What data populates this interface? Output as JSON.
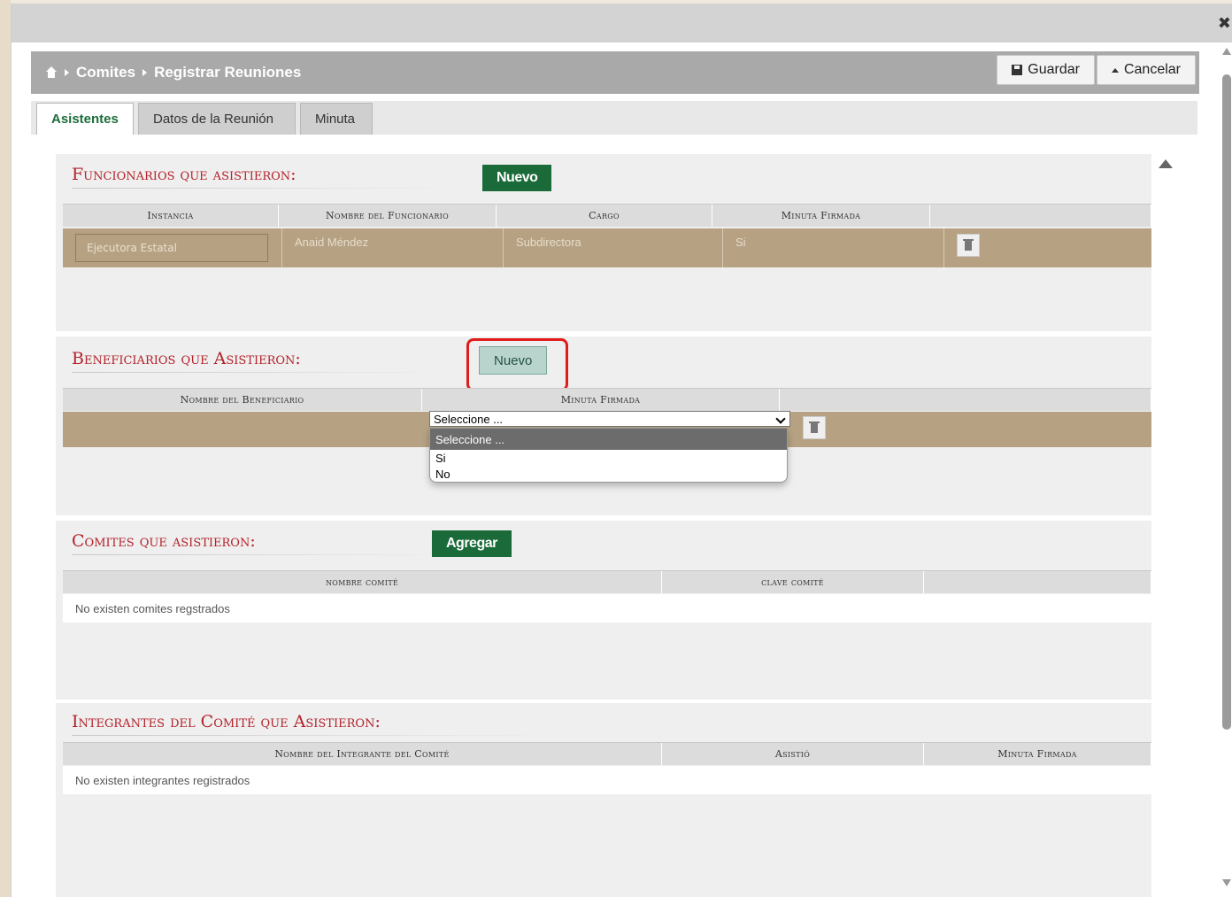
{
  "breadcrumb": {
    "items": [
      "Comites",
      "Registrar Reuniones"
    ]
  },
  "header": {
    "save_label": "Guardar",
    "cancel_label": "Cancelar"
  },
  "tabs": [
    {
      "label": "Asistentes",
      "active": true
    },
    {
      "label": "Datos de la Reunión",
      "active": false
    },
    {
      "label": "Minuta",
      "active": false
    }
  ],
  "funcionarios": {
    "title": "Funcionarios que asistieron:",
    "new_label": "Nuevo",
    "columns": [
      "Instancia",
      "Nombre del Funcionario",
      "Cargo",
      "Minuta Firmada",
      ""
    ],
    "rows": [
      {
        "instancia": "Ejecutora Estatal",
        "nombre": "Anaid Méndez",
        "cargo": "Subdirectora",
        "minuta": "Si"
      }
    ]
  },
  "beneficiarios": {
    "title": "Beneficiarios que Asistieron:",
    "new_label": "Nuevo",
    "columns": [
      "Nombre del Beneficiario",
      "Minuta Firmada",
      ""
    ],
    "select_value": "Seleccione ...",
    "options": [
      "Seleccione ...",
      "Si",
      "No"
    ]
  },
  "comites": {
    "title": "Comites que asistieron:",
    "add_label": "Agregar",
    "columns": [
      "nombre comité",
      "clave comité",
      ""
    ],
    "empty_text": "No existen comites regstrados"
  },
  "integrantes": {
    "title": "Integrantes del Comité que Asistieron:",
    "columns": [
      "Nombre del Integrante del Comité",
      "Asistió",
      "Minuta Firmada"
    ],
    "empty_text": "No existen integrantes registrados"
  },
  "colors": {
    "accent_green": "#1b6a3a",
    "title_red": "#b3222b",
    "row_tan": "#b6a283",
    "highlight_red": "#e01b1b"
  }
}
